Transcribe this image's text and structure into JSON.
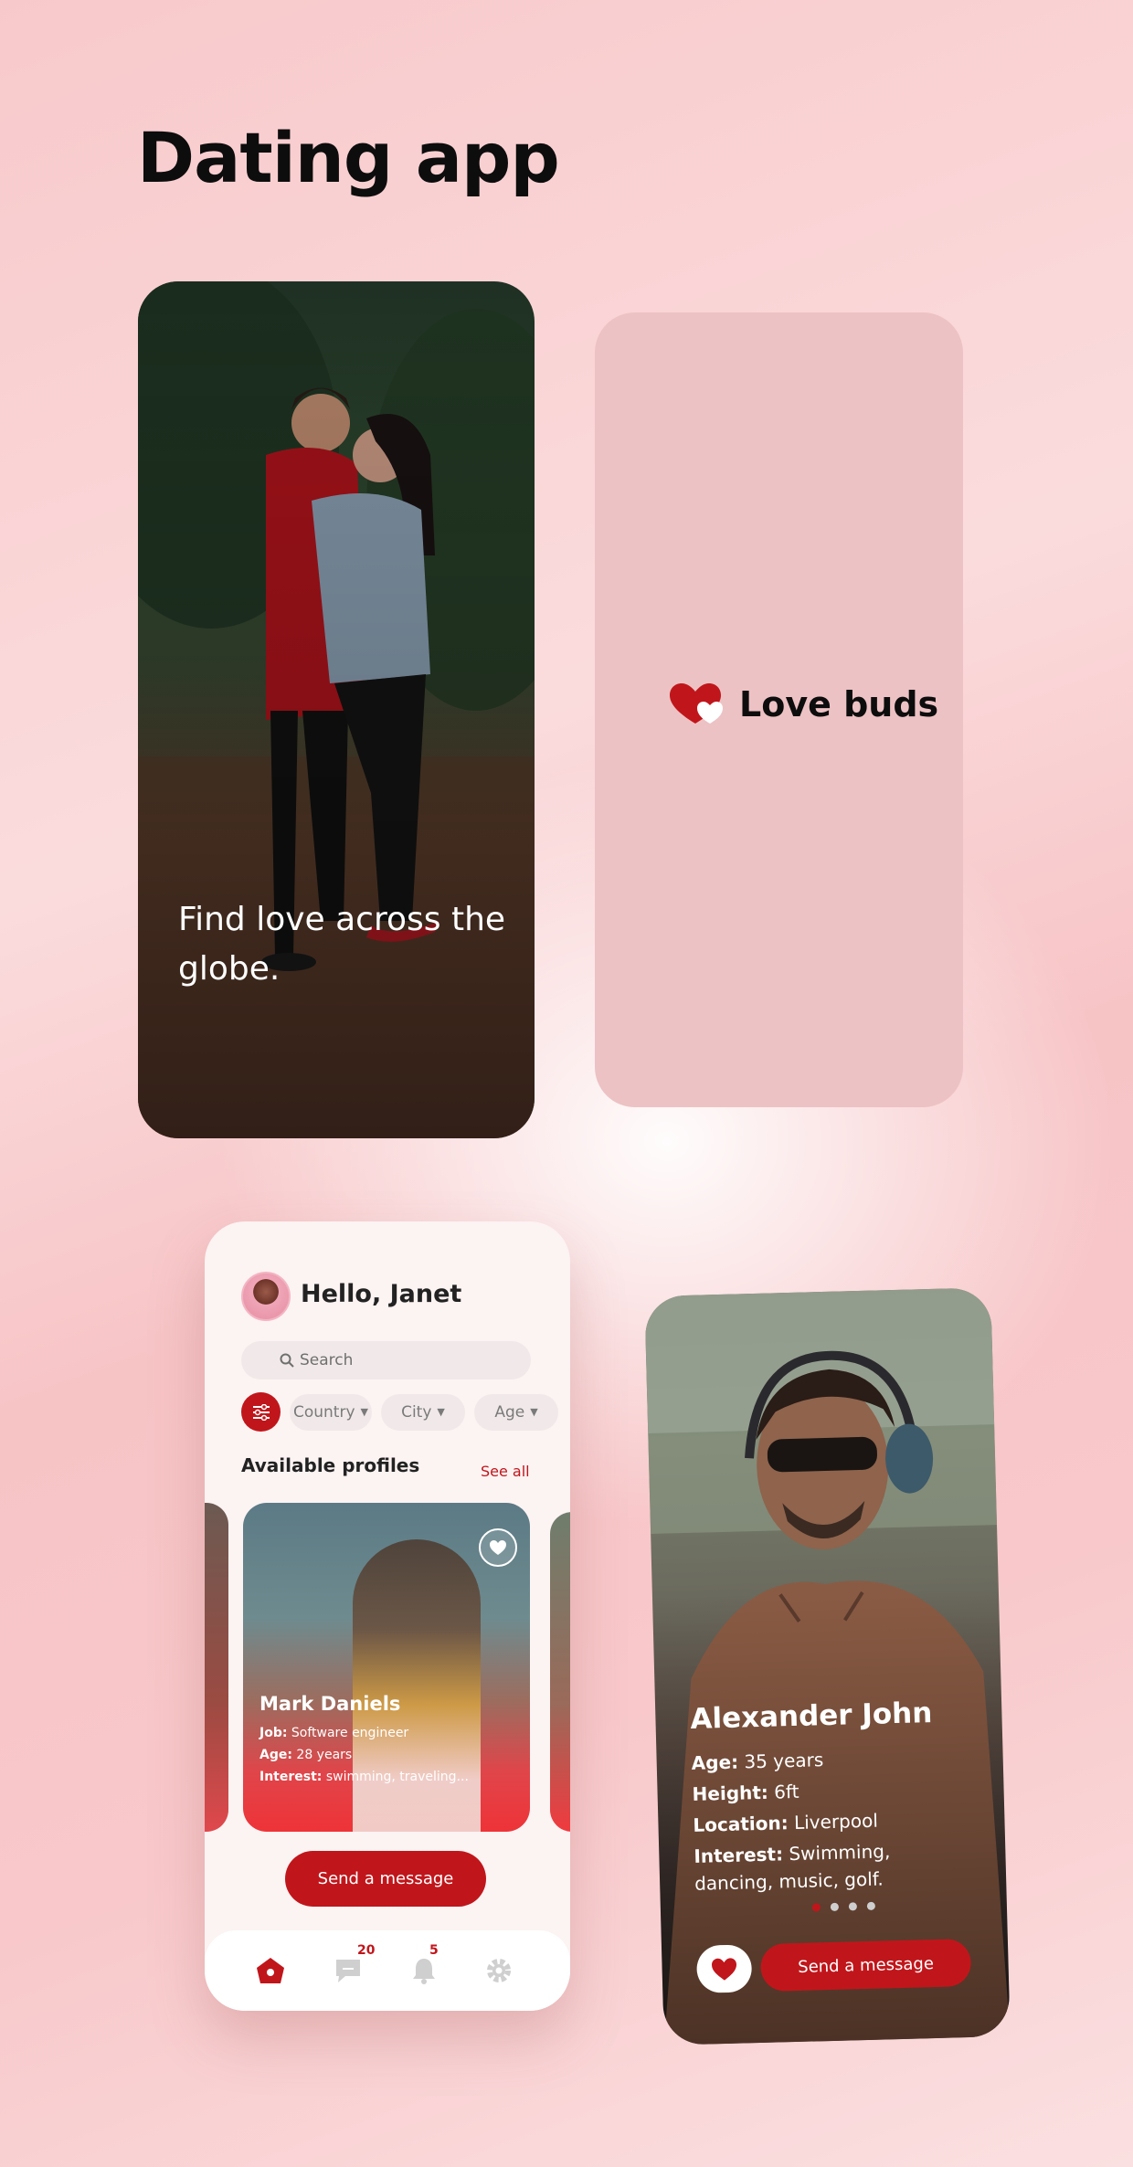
{
  "page": {
    "title": "Dating app"
  },
  "colors": {
    "accent": "#c0161b",
    "splash_bg": "#edc2c4"
  },
  "onboarding": {
    "caption": "Find love across the globe."
  },
  "splash": {
    "logo_icon": "hearts-icon",
    "logo_text": "Love buds"
  },
  "home": {
    "greeting": "Hello, Janet",
    "search": {
      "placeholder": "Search"
    },
    "filters": {
      "icon": "sliders-icon",
      "chips": [
        "Country",
        "City",
        "Age"
      ]
    },
    "section_title": "Available profiles",
    "see_all": "See all",
    "card": {
      "name": "Mark Daniels",
      "job_label": "Job:",
      "job": "Software engineer",
      "age_label": "Age:",
      "age": "28 years",
      "interest_label": "Interest:",
      "interest": "swimming, traveling..."
    },
    "send_button": "Send  a message",
    "tabs": [
      {
        "icon": "home-icon"
      },
      {
        "icon": "chat-icon",
        "badge": "20"
      },
      {
        "icon": "bell-icon",
        "badge": "5"
      },
      {
        "icon": "gear-icon"
      }
    ]
  },
  "profile": {
    "name": "Alexander John",
    "age_label": "Age:",
    "age": "35 years",
    "height_label": "Height:",
    "height": "6ft",
    "location_label": "Location:",
    "location": "Liverpool",
    "interest_label": "Interest:",
    "interest": "Swimming,",
    "interest_cont": "dancing, music, golf.",
    "pages": 4,
    "active_page": 1,
    "send_button": "Send  a message"
  }
}
